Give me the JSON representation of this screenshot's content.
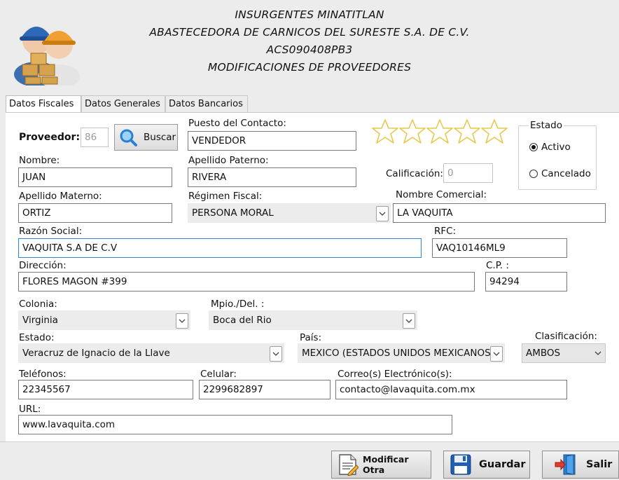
{
  "header": {
    "line1": "INSURGENTES MINATITLAN",
    "line2": "ABASTECEDORA DE CARNICOS DEL SURESTE S.A. DE C.V.",
    "line3": "ACS090408PB3",
    "line4": "MODIFICACIONES DE PROVEEDORES"
  },
  "tabs": [
    {
      "label": "Datos Fiscales",
      "active": true
    },
    {
      "label": "Datos Generales",
      "active": false
    },
    {
      "label": "Datos Bancarios",
      "active": false
    }
  ],
  "form": {
    "proveedor_label": "Proveedor:",
    "proveedor_value": "86",
    "buscar_label": "Buscar",
    "puesto_label": "Puesto del Contacto:",
    "puesto_value": "VENDEDOR",
    "nombre_label": "Nombre:",
    "nombre_value": "JUAN",
    "ap_paterno_label": "Apellido Paterno:",
    "ap_paterno_value": "RIVERA",
    "ap_materno_label": "Apellido Materno:",
    "ap_materno_value": "ORTIZ",
    "regimen_label": "Régimen Fiscal:",
    "regimen_value": "PERSONA MORAL",
    "nombre_comercial_label": "Nombre Comercial:",
    "nombre_comercial_value": "LA VAQUITA",
    "razon_social_label": "Razón Social:",
    "razon_social_value": "VAQUITA S.A DE C.V",
    "rfc_label": "RFC:",
    "rfc_value": "VAQ10146ML9",
    "direccion_label": "Dirección:",
    "direccion_value": "FLORES MAGON #399",
    "cp_label": "C.P. :",
    "cp_value": "94294",
    "colonia_label": "Colonia:",
    "colonia_value": "Virginia",
    "mpio_label": "Mpio./Del. :",
    "mpio_value": "Boca del Rio",
    "estado_label": "Estado:",
    "estado_value": "Veracruz de Ignacio de la Llave",
    "pais_label": "País:",
    "pais_value": "MEXICO (ESTADOS UNIDOS MEXICANOS)",
    "clasificacion_label": "Clasificación:",
    "clasificacion_value": "AMBOS",
    "telefonos_label": "Teléfonos:",
    "telefonos_value": "22345567",
    "celular_label": "Celular:",
    "celular_value": "2299682897",
    "correo_label": "Correo(s) Electrónico(s):",
    "correo_value": "contacto@lavaquita.com.mx",
    "url_label": "URL:",
    "url_value": "www.lavaquita.com",
    "calificacion_label": "Calificación:",
    "calificacion_value": "0",
    "rating_stars_filled": 0,
    "rating_stars_total": 5
  },
  "estado_group": {
    "title": "Estado",
    "options": [
      {
        "label": "Activo",
        "checked": true
      },
      {
        "label": "Cancelado",
        "checked": false
      }
    ]
  },
  "footer": {
    "modificar_label": "Modificar Otra",
    "guardar_label": "Guardar",
    "salir_label": "Salir"
  },
  "colors": {
    "star_outline": "#e8c84a",
    "focus_border": "#2f86d6",
    "search_icon_blue": "#2a7fd4"
  }
}
